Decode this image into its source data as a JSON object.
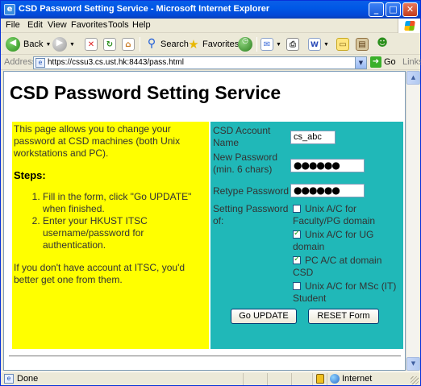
{
  "window": {
    "title": "CSD Password Setting Service - Microsoft Internet Explorer",
    "icon": "ie-icon",
    "controls": [
      "minimize-icon",
      "maximize-icon",
      "close-icon"
    ]
  },
  "menu": {
    "items": [
      "File",
      "Edit",
      "View",
      "Favorites",
      "Tools",
      "Help"
    ]
  },
  "toolbar": {
    "back_label": "Back",
    "search_label": "Search",
    "favorites_label": "Favorites"
  },
  "address": {
    "label": "Address",
    "url": "https://cssu3.cs.ust.hk:8443/pass.html",
    "go_label": "Go",
    "links_label": "Links"
  },
  "page": {
    "title": "CSD Password Setting Service",
    "left": {
      "intro": "This page allows you to change your password at CSD machines (both Unix workstations and PC).",
      "steps_heading": "Steps:",
      "steps": [
        "Fill in the form, click \"Go UPDATE\" when finished.",
        "Enter your HKUST ITSC username/password for authentication."
      ],
      "note": "If you don't have account at ITSC, you'd better get one from them."
    },
    "form": {
      "account_label": "CSD Account Name",
      "account_value": "cs_abc",
      "new_password_label": "New Password (min. 6 chars)",
      "new_password_value": "●●●●●●",
      "retype_label": "Retype Password",
      "retype_value": "●●●●●●",
      "setting_label": "Setting Password of:",
      "options": [
        {
          "label": "Unix A/C for Faculty/PG domain",
          "checked": false
        },
        {
          "label": "Unix A/C for UG domain",
          "checked": true
        },
        {
          "label": "PC A/C at domain CSD",
          "checked": true
        },
        {
          "label": "Unix A/C for MSc (IT) Student",
          "checked": false
        }
      ],
      "submit_label": "Go UPDATE",
      "reset_label": "RESET Form"
    },
    "colors": {
      "left_panel": "#ffff00",
      "right_panel": "#20b8b8"
    }
  },
  "status": {
    "text": "Done",
    "zone": "Internet"
  }
}
